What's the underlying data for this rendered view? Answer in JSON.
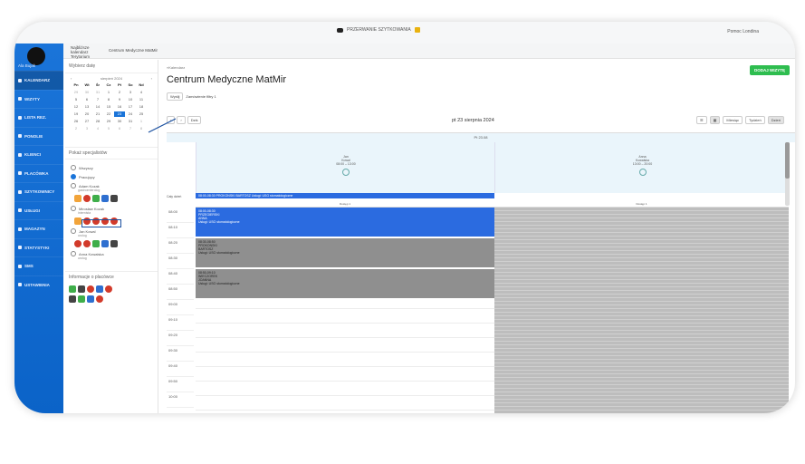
{
  "topbar": {
    "center_label": "PRZERWANIE SZYTKOWANIA",
    "right_label": "Pomoc Londina"
  },
  "sidebar": {
    "user_name": "Ala Bujak",
    "items": [
      {
        "label": "KALENDARZ"
      },
      {
        "label": "WIZYTY"
      },
      {
        "label": "LISTA REZ."
      },
      {
        "label": "PONOLIE"
      },
      {
        "label": "KLIENCI"
      },
      {
        "label": "PLACÓWKA"
      },
      {
        "label": "SZYTKOWNICY"
      },
      {
        "label": "USŁUGI"
      },
      {
        "label": "MAGAZYN"
      },
      {
        "label": "STATYSTYKI"
      },
      {
        "label": "SMS"
      },
      {
        "label": "USTAWIENIA"
      }
    ]
  },
  "crumbbar": {
    "c1": "Najbliższe kalendarz Terytorium",
    "c2": "Centrum Medyczne MatMir"
  },
  "leftpanel": {
    "date_head": "Wybierz datę",
    "month": "sierpień 2024",
    "weekdays": [
      "Pn",
      "Wt",
      "Śr",
      "Cz",
      "Pt",
      "So",
      "Nd"
    ],
    "weeks": [
      [
        "29",
        "30",
        "31",
        "1",
        "2",
        "3",
        "4"
      ],
      [
        "5",
        "6",
        "7",
        "8",
        "9",
        "10",
        "11"
      ],
      [
        "12",
        "13",
        "14",
        "15",
        "16",
        "17",
        "18"
      ],
      [
        "19",
        "20",
        "21",
        "22",
        "23",
        "24",
        "25"
      ],
      [
        "26",
        "27",
        "28",
        "29",
        "30",
        "31",
        "1"
      ],
      [
        "2",
        "3",
        "4",
        "5",
        "6",
        "7",
        "8"
      ]
    ],
    "spec_head": "Pokaż specjalistów",
    "specs": [
      {
        "name": "Wszyscy",
        "sub": ""
      },
      {
        "name": "Pracujący",
        "sub": ""
      },
      {
        "name": "Adam Kozak",
        "sub": "gastroenterolog"
      },
      {
        "name": "Mirosław Kozak",
        "sub": "internista"
      },
      {
        "name": "Jan Kowal",
        "sub": "urolog"
      },
      {
        "name": "Anna Kowalska",
        "sub": "urolog"
      }
    ],
    "info_head": "Informacje o placówce"
  },
  "main": {
    "crumb": "«Kalendarz",
    "title": "Centrum Medyczne MatMir",
    "filter_btn": "Wyślij",
    "filter_label": "Zamówienie filtry 1",
    "add_button": "DODAJ WIZYTĘ",
    "today_btn": "Dziś",
    "date": "pt 23 sierpnia 2024",
    "views": [
      "Miesiąc",
      "Tydzień",
      "Dzień"
    ],
    "day_label": "Pt 23.08",
    "columns": [
      {
        "name": "Jan",
        "surname": "Kowal",
        "hours": "08:00 – 13:00",
        "sub": "Dostęp 1"
      },
      {
        "name": "Anna",
        "surname": "Kowalska",
        "hours": "13:00 – 20:00",
        "sub": "Dostęp 1"
      }
    ],
    "allday_label": "Cały dzień",
    "allday_event": "08:00-08:30 PROKONSKI BARTOSZ Usługi: USG stomatologiczne",
    "times": [
      "08:00",
      "08:10",
      "08:20",
      "08:30",
      "08:40",
      "08:50",
      "09:00",
      "09:10",
      "09:20",
      "09:30",
      "09:40",
      "09:50",
      "10:00"
    ],
    "events": [
      {
        "time": "08:00-08:30",
        "name": "PRZEGIERSKI",
        "line": "ANNA",
        "service": "Usługi: USG stomatologiczne"
      },
      {
        "time": "08:30-08:50",
        "name": "PROKONSKI",
        "line": "BARTOSZ",
        "service": "Usługi: USG stomatologiczne"
      },
      {
        "time": "08:50-09:10",
        "name": "WIECZOREK",
        "line": "JOANNA",
        "service": "Usługi: USG stomatologiczne"
      }
    ]
  }
}
